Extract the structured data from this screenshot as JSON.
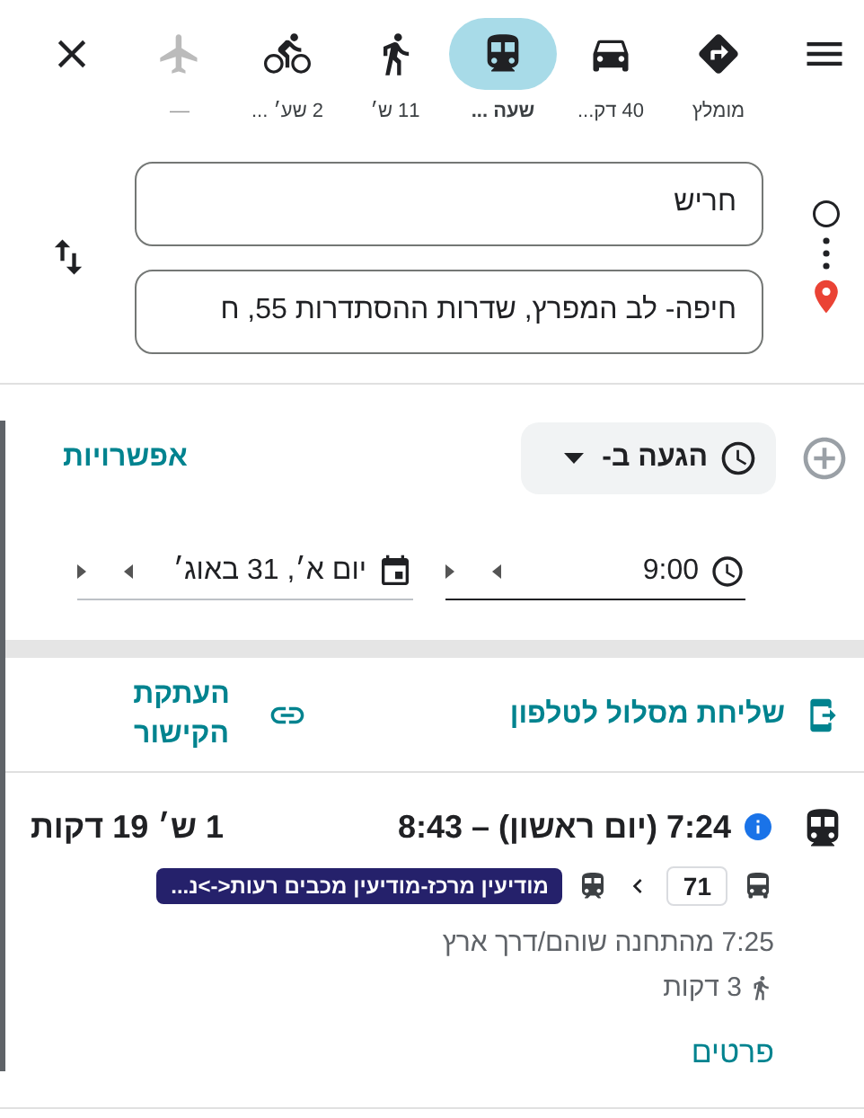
{
  "top_bar": {
    "modes": [
      {
        "kind": "recommended",
        "label": "מומלץ",
        "selected": false,
        "disabled": false
      },
      {
        "kind": "car",
        "label": "40 דק...",
        "selected": false,
        "disabled": false
      },
      {
        "kind": "transit",
        "label": "שעה ...",
        "selected": true,
        "disabled": false
      },
      {
        "kind": "walk",
        "label": "11 ש׳",
        "selected": false,
        "disabled": false
      },
      {
        "kind": "bike",
        "label": "2 שע׳ ...",
        "selected": false,
        "disabled": false
      },
      {
        "kind": "flight",
        "label": "—",
        "selected": false,
        "disabled": true
      }
    ]
  },
  "route_inputs": {
    "origin": "חריש",
    "destination": "חיפה- לב המפרץ, שדרות ההסתדרות 55, ח"
  },
  "options": {
    "time_mode": "הגעה ב-",
    "options_link": "אפשרויות",
    "time": "9:00",
    "date": "יום א׳, 31 באוג׳"
  },
  "share": {
    "send_to_phone": "שליחת מסלול לטלפון",
    "copy_link": "העתקת הקישור"
  },
  "routes": [
    {
      "times": "7:24 (יום ראשון) – 8:43",
      "duration": "1 ש׳ 19 דקות",
      "legs": [
        {
          "kind": "bus",
          "label": "71"
        },
        {
          "kind": "train",
          "label": "מודיעין מרכז-מודיעין מכבים רעות<->נ...",
          "color": "#25216b"
        }
      ],
      "departure": "7:25 מהתחנה שוהם/דרך ארץ",
      "walk": "3 דקות",
      "details_link": "פרטים"
    }
  ]
}
